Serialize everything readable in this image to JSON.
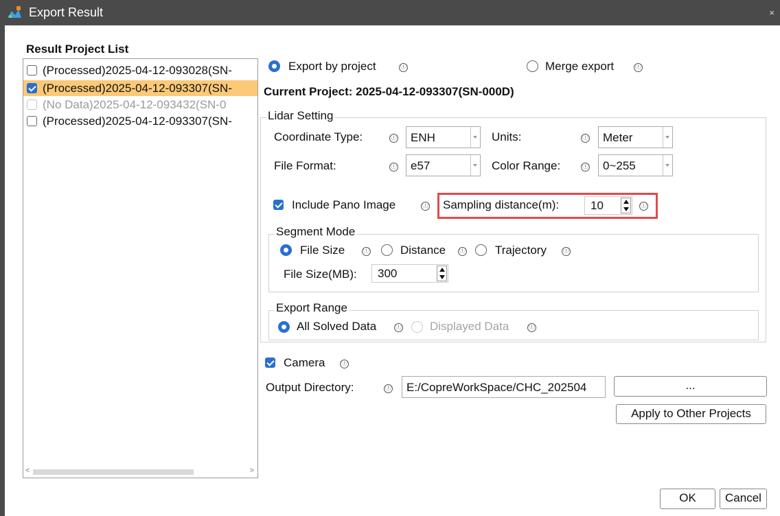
{
  "window": {
    "title": "Export Result",
    "close_glyph": "×",
    "app_icon": "app-logo-icon"
  },
  "list": {
    "heading": "Result Project List",
    "items": [
      {
        "label": "(Processed)2025-04-12-093028(SN-",
        "checked": false,
        "selected": false,
        "disabled": false
      },
      {
        "label": "(Processed)2025-04-12-093307(SN-",
        "checked": true,
        "selected": true,
        "disabled": false
      },
      {
        "label": "(No Data)2025-04-12-093432(SN-0",
        "checked": false,
        "selected": false,
        "disabled": true
      },
      {
        "label": "(Processed)2025-04-12-093307(SN-",
        "checked": false,
        "selected": false,
        "disabled": false
      }
    ],
    "scroll_left": "<",
    "scroll_right": ">"
  },
  "export_mode": {
    "by_project": "Export by project",
    "merge": "Merge export",
    "selected": "by_project"
  },
  "current_project": "Current Project: 2025-04-12-093307(SN-000D)",
  "lidar": {
    "legend": "Lidar Setting",
    "coord_type_label": "Coordinate Type:",
    "coord_type_value": "ENH",
    "units_label": "Units:",
    "units_value": "Meter",
    "file_format_label": "File Format:",
    "file_format_value": "e57",
    "color_range_label": "Color Range:",
    "color_range_value": "0~255",
    "include_pano_label": "Include Pano Image",
    "include_pano_checked": true,
    "sampling_label": "Sampling distance(m):",
    "sampling_value": "10"
  },
  "segment": {
    "legend": "Segment Mode",
    "file_size": "File Size",
    "distance": "Distance",
    "trajectory": "Trajectory",
    "selected": "file_size",
    "file_size_label": "File Size(MB):",
    "file_size_value": "300"
  },
  "export_range": {
    "legend": "Export Range",
    "all": "All Solved Data",
    "displayed": "Displayed Data",
    "selected": "all"
  },
  "camera": {
    "label": "Camera",
    "checked": true
  },
  "output": {
    "label": "Output Directory:",
    "value": "E:/CopreWorkSpace/CHC_202504",
    "browse": "...",
    "apply": "Apply to Other Projects"
  },
  "info_glyph": "ⓘ",
  "buttons": {
    "ok": "OK",
    "cancel": "Cancel"
  },
  "colors": {
    "accent": "#2a6fd1",
    "selection": "#fbc978",
    "highlight": "#e24a4a",
    "titlebar": "#4a4a4a"
  }
}
